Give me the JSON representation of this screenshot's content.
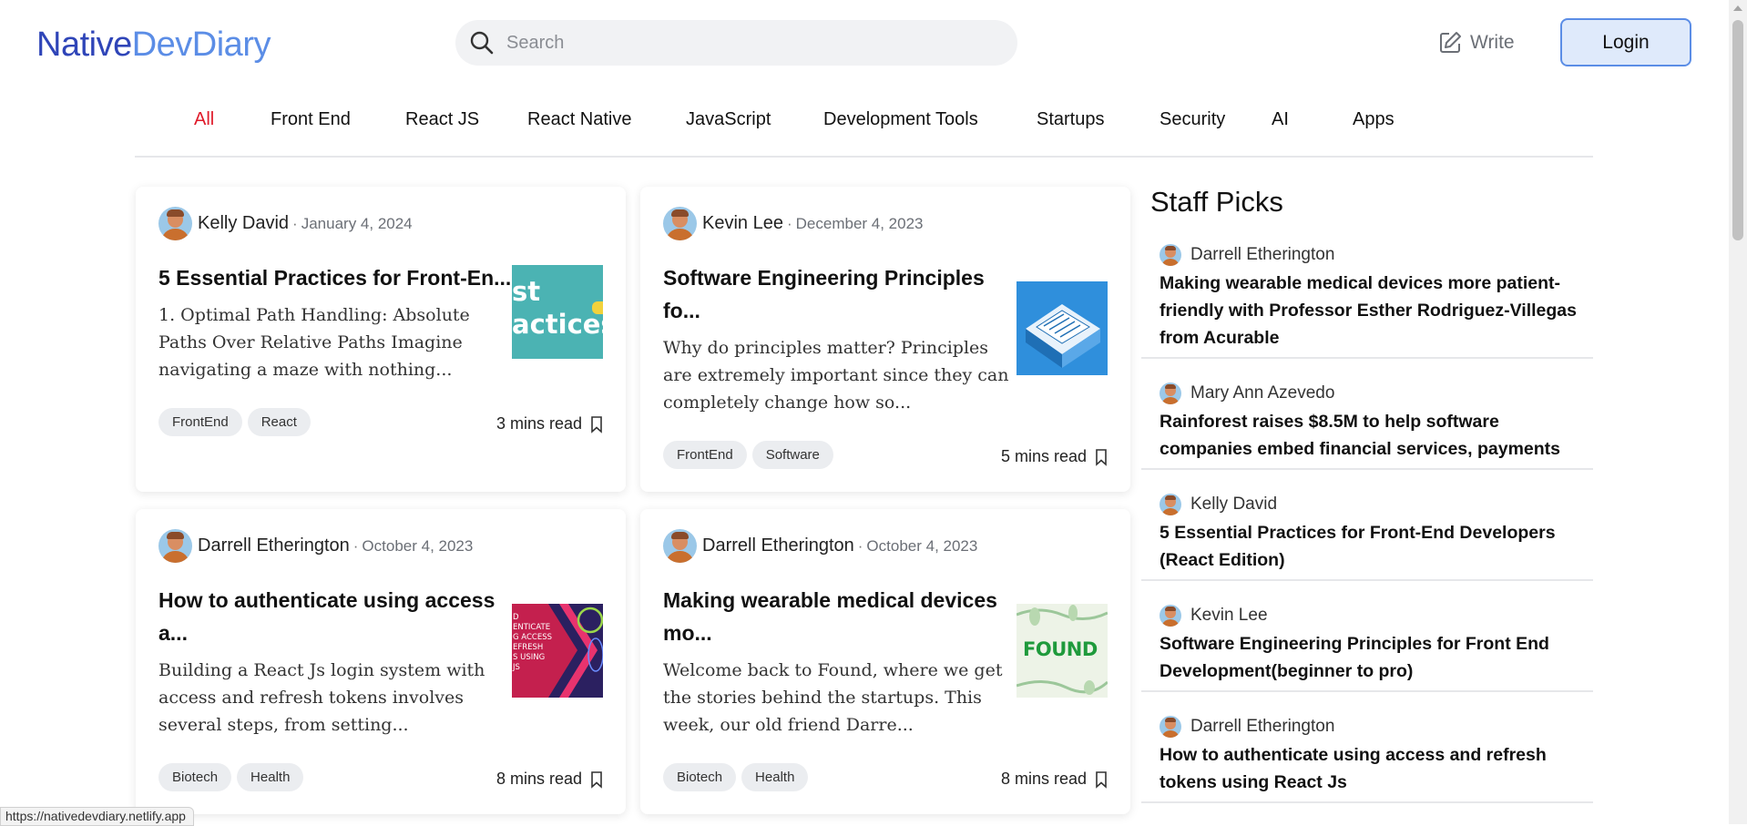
{
  "brand": {
    "part1": "Native",
    "part2": "DevDiary",
    "color1": "#2f45b8",
    "color2": "#5b8de6"
  },
  "search": {
    "placeholder": "Search",
    "icon": "search-icon"
  },
  "header": {
    "write_label": "Write",
    "write_icon": "pencil-square-icon",
    "login_label": "Login"
  },
  "categories": [
    "All",
    "Front End",
    "React JS",
    "React Native",
    "JavaScript",
    "Development Tools",
    "Startups",
    "Security",
    "AI",
    "Apps"
  ],
  "active_category": "All",
  "accent_colors": {
    "active_category": "#e01b2a",
    "login_bg": "#dfeafb"
  },
  "posts": [
    {
      "author": "Kelly David",
      "date": "January 4, 2024",
      "title": "5 Essential Practices for Front-En...",
      "excerpt": "1. Optimal Path Handling: Absolute Paths Over Relative Paths Imagine navigating a maze with nothing...",
      "tags": [
        "FrontEnd",
        "React"
      ],
      "read_time": "3 mins read",
      "thumb_text": [
        "st",
        "actices"
      ]
    },
    {
      "author": "Kevin Lee",
      "date": "December 4, 2023",
      "title": "Software Engineering Principles fo...",
      "excerpt": "Why do principles matter? Principles are extremely important since they can completely change how so...",
      "tags": [
        "FrontEnd",
        "Software"
      ],
      "read_time": "5 mins read"
    },
    {
      "author": "Darrell Etherington",
      "date": "October 4, 2023",
      "title": "How to authenticate using access a...",
      "excerpt": "Building a React Js login system with access and refresh tokens involves several steps, from setting...",
      "tags": [
        "Biotech",
        "Health"
      ],
      "read_time": "8 mins read",
      "thumb_text": [
        "D",
        "ENTICATE",
        "G ACCESS",
        "EFRESH",
        "S USING",
        "JS"
      ]
    },
    {
      "author": "Darrell Etherington",
      "date": "October 4, 2023",
      "title": "Making wearable medical devices mo...",
      "excerpt": "Welcome back to Found, where we get the stories behind the startups. This week, our old friend Darre...",
      "tags": [
        "Biotech",
        "Health"
      ],
      "read_time": "8 mins read",
      "thumb_text": [
        "FOUND"
      ]
    }
  ],
  "staff_picks": {
    "title": "Staff Picks",
    "items": [
      {
        "author": "Darrell Etherington",
        "title": "Making wearable medical devices more patient-friendly with Professor Esther Rodriguez-Villegas from Acurable"
      },
      {
        "author": "Mary Ann Azevedo",
        "title": "Rainforest raises $8.5M to help software companies embed financial services, payments"
      },
      {
        "author": "Kelly David",
        "title": "5 Essential Practices for Front-End Developers (React Edition)"
      },
      {
        "author": "Kevin Lee",
        "title": "Software Engineering Principles for Front End Development(beginner to pro)"
      },
      {
        "author": "Darrell Etherington",
        "title": "How to authenticate using access and refresh tokens using React Js"
      }
    ]
  },
  "status_bar": {
    "url": "https://nativedevdiary.netlify.app"
  }
}
